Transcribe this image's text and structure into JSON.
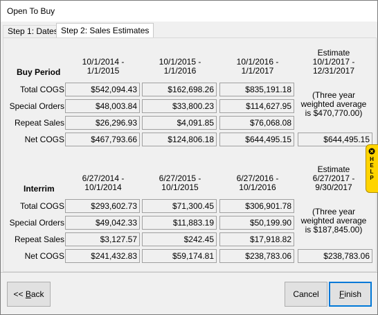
{
  "window": {
    "title": "Open To Buy"
  },
  "tabs": [
    {
      "label": "Step 1: Dates"
    },
    {
      "label": "Step 2: Sales Estimates"
    }
  ],
  "buy_period": {
    "title": "Buy Period",
    "headers": [
      [
        "10/1/2014 -",
        "1/1/2015"
      ],
      [
        "10/1/2015 -",
        "1/1/2016"
      ],
      [
        "10/1/2016 -",
        "1/1/2017"
      ],
      [
        "Estimate",
        "10/1/2017 -",
        "12/31/2017"
      ]
    ],
    "row_labels": [
      "Total COGS",
      "Special Orders",
      "Repeat Sales",
      "Net COGS"
    ],
    "values": [
      [
        "$542,094.43",
        "$162,698.26",
        "$835,191.18"
      ],
      [
        "$48,003.84",
        "$33,800.23",
        "$114,627.95"
      ],
      [
        "$26,296.93",
        "$4,091.85",
        "$76,068.08"
      ],
      [
        "$467,793.66",
        "$124,806.18",
        "$644,495.15"
      ]
    ],
    "note": [
      "(Three year",
      "weighted average",
      "is $470,770.00)"
    ],
    "estimate": "$644,495.15"
  },
  "interim": {
    "title": "Interrim",
    "headers": [
      [
        "6/27/2014 -",
        "10/1/2014"
      ],
      [
        "6/27/2015 -",
        "10/1/2015"
      ],
      [
        "6/27/2016 -",
        "10/1/2016"
      ],
      [
        "Estimate",
        "6/27/2017 -",
        "9/30/2017"
      ]
    ],
    "row_labels": [
      "Total COGS",
      "Special Orders",
      "Repeat Sales",
      "Net COGS"
    ],
    "values": [
      [
        "$293,602.73",
        "$71,300.45",
        "$306,901.78"
      ],
      [
        "$49,042.33",
        "$11,883.19",
        "$50,199.90"
      ],
      [
        "$3,127.57",
        "$242.45",
        "$17,918.82"
      ],
      [
        "$241,432.83",
        "$59,174.81",
        "$238,783.06"
      ]
    ],
    "note": [
      "(Three year",
      "weighted average",
      "is $187,845.00)"
    ],
    "estimate": "$238,783.06"
  },
  "help": {
    "label": "HELP",
    "icon": "close-x-icon"
  },
  "buttons": {
    "back": {
      "underline": "B",
      "before": "<< ",
      "after": "ack"
    },
    "cancel": "Cancel",
    "finish": {
      "underline": "F",
      "after": "inish"
    }
  },
  "colors": {
    "accent": "#0078d7",
    "help": "#ffd400"
  }
}
